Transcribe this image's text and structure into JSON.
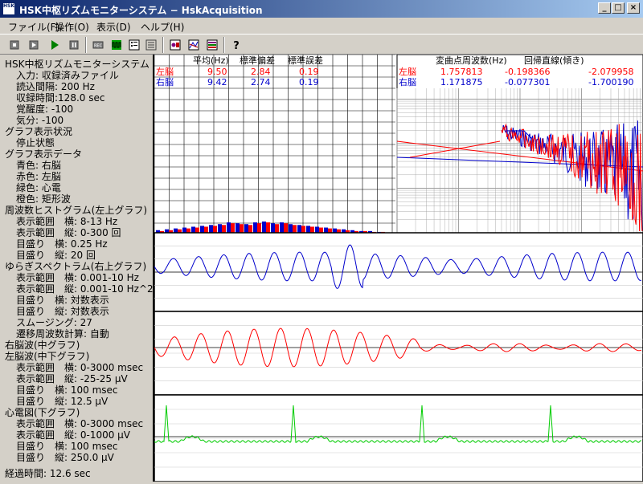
{
  "window": {
    "title": "HSK中枢リズムモニターシステム − HskAcquisition",
    "icon_label": "HSK",
    "minimize": "_",
    "maximize": "□",
    "close": "×"
  },
  "menu": [
    {
      "label": "ファイル(F)"
    },
    {
      "label": "操作(O)"
    },
    {
      "label": "表示(D)"
    },
    {
      "label": "ヘルプ(H)"
    }
  ],
  "toolbar": {
    "icons": [
      "stop-record-icon",
      "step-icon",
      "play-icon",
      "pause-icon",
      "rec-icon",
      "waveform-icon",
      "list-icon",
      "settings-icon",
      "config-icon",
      "filter-icon",
      "chart-icon",
      "help-icon"
    ],
    "rec_label": "REC",
    "help_glyph": "?"
  },
  "info_panel": {
    "lines": [
      "HSK中枢リズムモニターシステム",
      "入力: 収録済みファイル",
      "読込間隔: 200 Hz",
      "収録時間:128.0 sec",
      "覚醒度: -100",
      "気分: -100",
      "グラフ表示状況",
      "停止状態",
      "グラフ表示データ",
      "青色: 右脳",
      "赤色: 左脳",
      "緑色: 心電",
      "橙色: 矩形波",
      "周波数ヒストグラム(左上グラフ)",
      "表示範囲　横: 8-13 Hz",
      "表示範囲　縦: 0-300 回",
      "目盛り　横: 0.25 Hz",
      "目盛り　縦: 20 回",
      "ゆらぎスペクトラム(右上グラフ)",
      "表示範囲　横: 0.001-10 Hz",
      "表示範囲　縦: 0.001-10 Hz^2",
      "目盛り　横: 対数表示",
      "目盛り　縦: 対数表示",
      "スムージング: 27",
      "遷移周波数計算: 自動",
      "右脳波(中グラフ)",
      "左脳波(中下グラフ)",
      "表示範囲　横: 0-3000 msec",
      "表示範囲　縦: -25-25 μV",
      "目盛り　横: 100 msec",
      "目盛り　縦: 12.5 μV",
      "心電図(下グラフ)",
      "表示範囲　横: 0-3000 msec",
      "表示範囲　縦: 0-1000 μV",
      "目盛り　横: 100 msec",
      "目盛り　縦: 250.0 μV",
      "経過時間: 12.6 sec"
    ]
  },
  "histogram": {
    "headers": [
      "平均(Hz)",
      "標準偏差",
      "標準誤差"
    ],
    "rows": [
      {
        "label": "左脳",
        "values": [
          "9.50",
          "2.84",
          "0.19"
        ],
        "color": "#ff0000"
      },
      {
        "label": "右脳",
        "values": [
          "9.42",
          "2.74",
          "0.19"
        ],
        "color": "#0000cc"
      }
    ],
    "blue_bins": [
      3,
      4,
      5,
      6,
      7,
      8,
      9,
      10,
      12,
      11,
      10,
      12,
      13,
      11,
      12,
      10,
      9,
      8,
      7,
      6,
      5,
      4,
      3,
      2,
      2,
      1
    ],
    "red_bins": [
      2,
      3,
      4,
      5,
      6,
      7,
      8,
      9,
      11,
      10,
      9,
      11,
      12,
      10,
      11,
      9,
      8,
      7,
      6,
      5,
      4,
      3,
      2,
      2,
      1,
      1
    ]
  },
  "spectrum": {
    "headers": [
      "変曲点周波数(Hz)",
      "回帰直線(傾き)"
    ],
    "rows": [
      {
        "label": "左脳",
        "values": [
          "1.757813",
          "-0.198366",
          "-2.079958"
        ],
        "color": "#ff0000"
      },
      {
        "label": "右脳",
        "values": [
          "1.171875",
          "-0.077301",
          "-1.700190"
        ],
        "color": "#0000cc"
      }
    ]
  },
  "colors": {
    "right_brain": "#0000cc",
    "left_brain": "#ff0000",
    "ecg": "#00cc00",
    "titlebar": "#0a246a"
  }
}
